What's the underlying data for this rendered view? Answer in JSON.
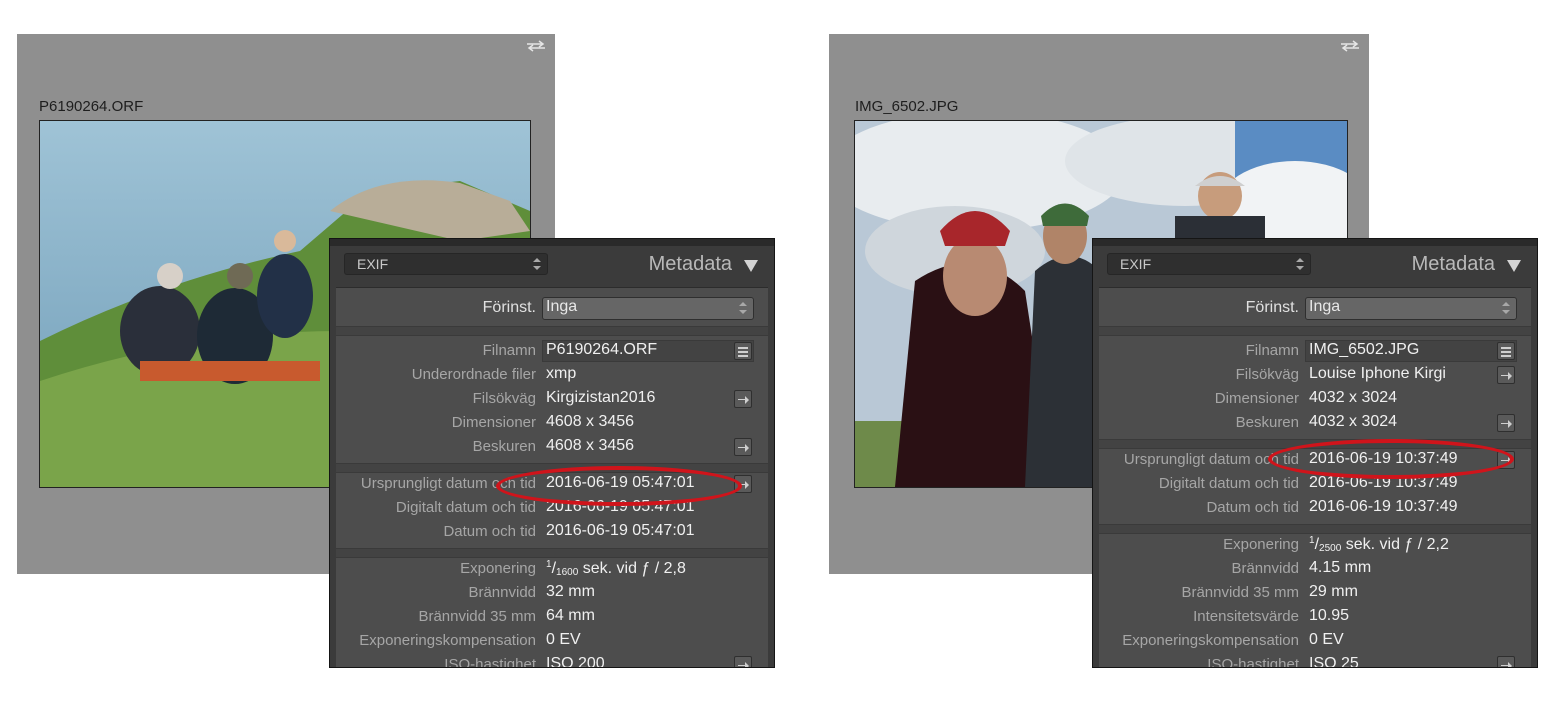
{
  "panel_common": {
    "preset_select_value": "EXIF",
    "title": "Metadata",
    "preset_label": "Förinst.",
    "preset_value": "Inga"
  },
  "left": {
    "filename": "P6190264.ORF",
    "rows": {
      "filnamn": {
        "label": "Filnamn",
        "value": "P6190264.ORF"
      },
      "underordnade": {
        "label": "Underordnade filer",
        "value": "xmp"
      },
      "filsokvag": {
        "label": "Filsökväg",
        "value": "Kirgizistan2016"
      },
      "dimensioner": {
        "label": "Dimensioner",
        "value": "4608 x 3456"
      },
      "beskuren": {
        "label": "Beskuren",
        "value": "4608 x 3456"
      },
      "ursprungligt": {
        "label": "Ursprungligt datum och tid",
        "value": "2016-06-19 05:47:01"
      },
      "digitalt": {
        "label": "Digitalt datum och tid",
        "value": "2016-06-19 05:47:01"
      },
      "datum": {
        "label": "Datum och tid",
        "value": "2016-06-19 05:47:01"
      },
      "exponering": {
        "label": "Exponering",
        "numer": "1",
        "denom": "1600",
        "value": "sek. vid ƒ / 2,8"
      },
      "brannvidd": {
        "label": "Brännvidd",
        "value": "32 mm"
      },
      "brannvidd35": {
        "label": "Brännvidd 35 mm",
        "value": "64 mm"
      },
      "expkomp": {
        "label": "Exponeringskompensation",
        "value": "0 EV"
      },
      "iso": {
        "label": "ISO-hastighet",
        "value": "ISO 200"
      }
    }
  },
  "right": {
    "filename": "IMG_6502.JPG",
    "rows": {
      "filnamn": {
        "label": "Filnamn",
        "value": "IMG_6502.JPG"
      },
      "filsokvag": {
        "label": "Filsökväg",
        "value": "Louise Iphone Kirgi"
      },
      "dimensioner": {
        "label": "Dimensioner",
        "value": "4032 x 3024"
      },
      "beskuren": {
        "label": "Beskuren",
        "value": "4032 x 3024"
      },
      "ursprungligt": {
        "label": "Ursprungligt datum och tid",
        "value": "2016-06-19 10:37:49"
      },
      "digitalt": {
        "label": "Digitalt datum och tid",
        "value": "2016-06-19 10:37:49"
      },
      "datum": {
        "label": "Datum och tid",
        "value": "2016-06-19 10:37:49"
      },
      "exponering": {
        "label": "Exponering",
        "numer": "1",
        "denom": "2500",
        "value": "sek. vid ƒ / 2,2"
      },
      "brannvidd": {
        "label": "Brännvidd",
        "value": "4.15 mm"
      },
      "brannvidd35": {
        "label": "Brännvidd 35 mm",
        "value": "29 mm"
      },
      "intensitet": {
        "label": "Intensitetsvärde",
        "value": "10.95"
      },
      "expkomp": {
        "label": "Exponeringskompensation",
        "value": "0 EV"
      },
      "iso": {
        "label": "ISO-hastighet",
        "value": "ISO 25"
      }
    }
  },
  "colors": {
    "highlight": "#d0141b",
    "panel_bg": "#4d4d4d",
    "viewer_bg": "#8f8f8f"
  }
}
